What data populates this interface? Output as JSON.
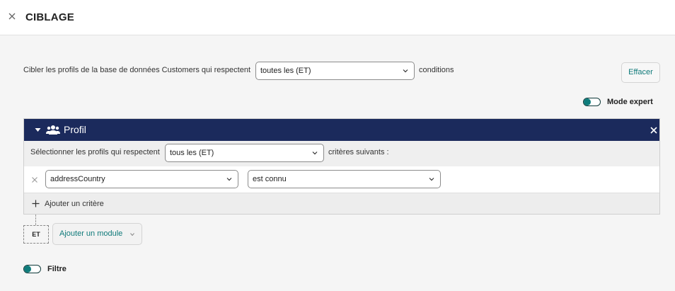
{
  "header": {
    "title": "CIBLAGE",
    "close_icon": "close-icon"
  },
  "targeting": {
    "prefix": "Cibler les profils de la base de données Customers qui respectent",
    "match_value": "toutes les (ET)",
    "suffix": "conditions",
    "clear_label": "Effacer"
  },
  "expert_mode": {
    "label": "Mode expert",
    "enabled": false
  },
  "module": {
    "title": "Profil",
    "icon": "users-icon",
    "select_prefix": "Sélectionner les profils qui respectent",
    "match_value": "tous les (ET)",
    "select_suffix": "critères suivants :",
    "criteria": [
      {
        "field": "addressCountry",
        "operator": "est connu"
      }
    ],
    "add_criterion_label": "Ajouter un critère"
  },
  "logic": {
    "operator_label": "ET",
    "add_module_label": "Ajouter un module"
  },
  "filter": {
    "label": "Filtre",
    "enabled": false
  },
  "colors": {
    "accent": "#0e7c7b",
    "module_header": "#1b2a5c"
  }
}
